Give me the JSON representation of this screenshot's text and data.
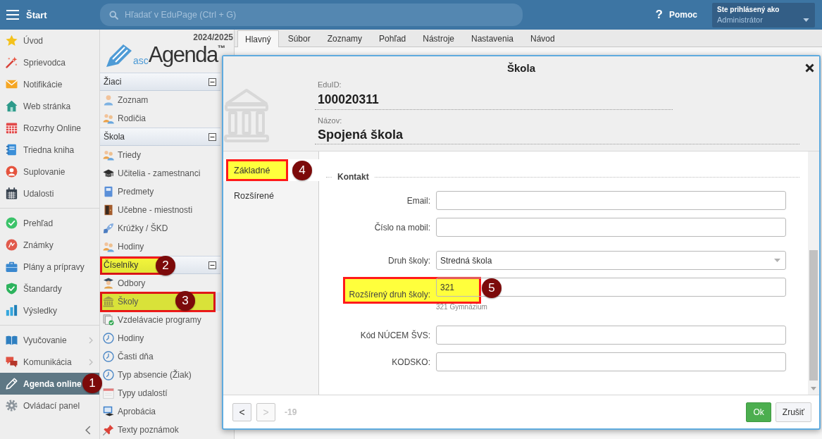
{
  "top_bar": {
    "menu_label": "Štart",
    "search": {
      "placeholder": "Hľadať v EduPage (Ctrl + G)"
    },
    "help": {
      "icon": "?",
      "label": "Pomoc"
    },
    "user": {
      "caption": "Ste prihlásený ako",
      "name": "Administrátor"
    }
  },
  "sidebar": {
    "groups": [
      {
        "items": [
          {
            "label": "Úvod",
            "selected": false,
            "submenu": false
          },
          {
            "label": "Sprievodca",
            "selected": false,
            "submenu": false
          },
          {
            "label": "Notifikácie",
            "selected": false,
            "submenu": false
          },
          {
            "label": "Web stránka",
            "selected": false,
            "submenu": false
          },
          {
            "label": "Rozvrhy Online",
            "selected": false,
            "submenu": false
          },
          {
            "label": "Triedna kniha",
            "selected": false,
            "submenu": false
          },
          {
            "label": "Suplovanie",
            "selected": false,
            "submenu": false
          },
          {
            "label": "Udalosti",
            "selected": false,
            "submenu": false
          }
        ]
      },
      {
        "items": [
          {
            "label": "Prehľad",
            "selected": false,
            "submenu": false
          },
          {
            "label": "Známky",
            "selected": false,
            "submenu": false
          },
          {
            "label": "Plány a prípravy",
            "selected": false,
            "submenu": false
          },
          {
            "label": "Štandardy",
            "selected": false,
            "submenu": false
          },
          {
            "label": "Výsledky",
            "selected": false,
            "submenu": false
          }
        ]
      },
      {
        "items": [
          {
            "label": "Vyučovanie",
            "selected": false,
            "submenu": true
          },
          {
            "label": "Komunikácia",
            "selected": false,
            "submenu": true
          },
          {
            "label": "Agenda online",
            "selected": true,
            "submenu": false,
            "callout": {
              "number": "1",
              "boxed": false
            }
          },
          {
            "label": "Ovládací panel",
            "selected": false,
            "submenu": false
          }
        ]
      }
    ]
  },
  "agenda_panel": {
    "year": "2024/2025",
    "logo": {
      "prefix": "asc",
      "name": "Agenda$^{™}$"
    },
    "sections": [
      {
        "title": "Žiaci",
        "expanded": true,
        "items": [
          {
            "label": "Zoznam",
            "selected": false
          },
          {
            "label": "Rodičia",
            "selected": false
          }
        ]
      },
      {
        "title": "Škola",
        "expanded": true,
        "items": [
          {
            "label": "Triedy",
            "selected": false
          },
          {
            "label": "Učitelia - zamestnanci",
            "selected": false
          },
          {
            "label": "Predmety",
            "selected": false
          },
          {
            "label": "Učebne - miestnosti",
            "selected": false
          },
          {
            "label": "Krúžky / ŠKD",
            "selected": false
          },
          {
            "label": "Hodiny",
            "selected": false
          }
        ]
      },
      {
        "title": "Číselníky",
        "expanded": true,
        "callout": {
          "number": "2",
          "boxed": true
        },
        "items": [
          {
            "label": "Odbory",
            "selected": false
          },
          {
            "label": "Školy",
            "selected": true,
            "callout": {
              "number": "3",
              "boxed": true
            }
          },
          {
            "label": "Vzdelávacie programy",
            "selected": false
          },
          {
            "label": "Hodiny",
            "selected": false
          },
          {
            "label": "Časti dňa",
            "selected": false
          },
          {
            "label": "Typ absencie (Žiak)",
            "selected": false
          },
          {
            "label": "Typy udalostí",
            "selected": false
          },
          {
            "label": "Aprobácia",
            "selected": false
          },
          {
            "label": "Texty poznámok",
            "selected": false
          }
        ]
      }
    ]
  },
  "ribbon_tabs": [
    {
      "label": "Hlavný",
      "selected": true
    },
    {
      "label": "Súbor",
      "selected": false
    },
    {
      "label": "Zoznamy",
      "selected": false
    },
    {
      "label": "Pohľad",
      "selected": false
    },
    {
      "label": "Nástroje",
      "selected": false
    },
    {
      "label": "Nastavenia",
      "selected": false
    },
    {
      "label": "Návod",
      "selected": false
    }
  ],
  "dialog": {
    "title": "Škola",
    "edu_id": {
      "label": "EduID:",
      "value": "100020311"
    },
    "name": {
      "label": "Názov:",
      "value": "Spojená škola"
    },
    "tabs": [
      {
        "label": "Základné",
        "selected": true,
        "callout": {
          "number": "4",
          "boxed": true
        }
      },
      {
        "label": "Rozšírené",
        "selected": false
      }
    ],
    "section_title": "Kontakt",
    "field_groups": [
      [
        {
          "kind": "text",
          "label": "Email:"
        },
        {
          "kind": "text",
          "label": "Číslo na mobil:"
        }
      ],
      [
        {
          "kind": "select",
          "label": "Druh školy:",
          "value": "Stredná škola"
        },
        {
          "kind": "text",
          "label": "Rozšírený druh školy:",
          "value": "321",
          "hint": "321 Gymnázium",
          "callout": {
            "number": "5",
            "boxed": true
          }
        }
      ],
      [
        {
          "kind": "text",
          "label": "Kód NÚCEM ŠVS:"
        },
        {
          "kind": "text",
          "label": "KODSKO:"
        }
      ]
    ],
    "footer": {
      "pager": [
        {
          "label": "<",
          "disabled": false
        },
        {
          "label": ">",
          "disabled": true
        }
      ],
      "counter": "-19",
      "actions": [
        {
          "kind": "primary",
          "label": "Ok"
        },
        {
          "kind": "secondary",
          "label": "Zrušiť"
        }
      ]
    }
  }
}
